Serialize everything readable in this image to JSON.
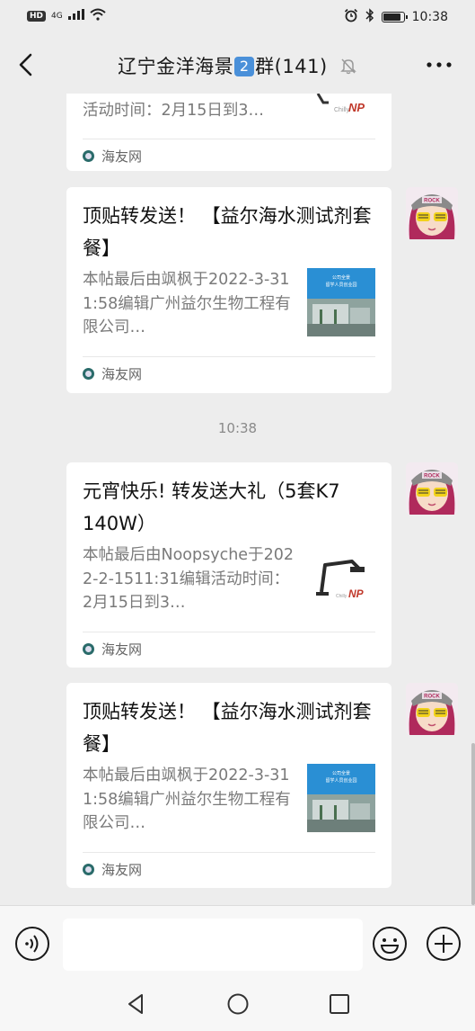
{
  "status_bar": {
    "hd": "HD",
    "network": "4G",
    "time": "10:38"
  },
  "header": {
    "title_before": "辽宁金洋海景",
    "title_badge": "2",
    "title_after": "群(141)",
    "icons": [
      "back-arrow-icon",
      "mute-bell-icon",
      "more-dots-icon"
    ]
  },
  "messages": [
    {
      "desc_line": "活动时间：2月15日到3…",
      "site": "海友网",
      "thumb_text": "NP"
    },
    {
      "title": "顶贴转发送！ 【益尔海水测试剂套餐】",
      "desc": "本帖最后由飒枫于2022-3-311:58编辑广州益尔生物工程有限公司…",
      "site": "海友网",
      "thumb_text": "公司全景 留学人员创业园"
    },
    {
      "timestamp": "10:38"
    },
    {
      "title": "元宵快乐! 转发送大礼（5套K7 140W）",
      "desc": "本帖最后由Noopsyche于2022-2-1511:31编辑活动时间：2月15日到3…",
      "site": "海友网",
      "thumb_text": "NP"
    },
    {
      "title": "顶贴转发送！ 【益尔海水测试剂套餐】",
      "desc": "本帖最后由飒枫于2022-3-311:58编辑广州益尔生物工程有限公司…",
      "site": "海友网",
      "thumb_text": "公司全景 留学人员创业园"
    }
  ],
  "avatar": {
    "badge_text": "ROCK",
    "colors": {
      "hair": "#b02a5c",
      "hat": "#8a8a8a",
      "glasses": "#f2d21a"
    }
  },
  "input_bar": {
    "placeholder": "",
    "icons": [
      "voice-icon",
      "emoji-icon",
      "plus-icon"
    ]
  },
  "nav_bar": {
    "icons": [
      "nav-back-icon",
      "nav-home-icon",
      "nav-recent-icon"
    ]
  },
  "colors": {
    "background": "#ededed",
    "card": "#ffffff",
    "title_badge": "#4a90d9"
  }
}
